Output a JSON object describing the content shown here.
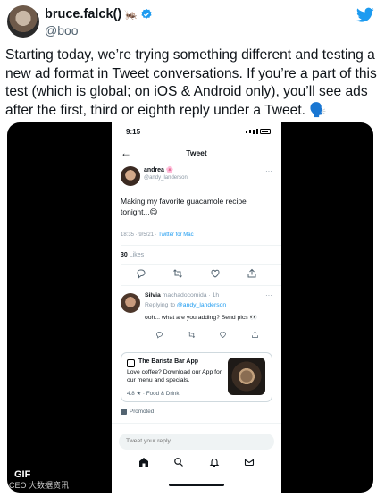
{
  "tweet": {
    "display_name": "bruce.falck()",
    "name_emoji": "🦗",
    "handle": "@boo",
    "text": "Starting today, we’re trying something different and testing a new ad format in Tweet conversations. If you’re a part of this test (which is global; on iOS & Android only), you’ll see ads after the first, third or eighth reply under a Tweet. 🗣️",
    "brand_color": "#1d9bf0"
  },
  "media": {
    "badge": "GIF",
    "watermark": "CEO 大数据资讯"
  },
  "phone": {
    "status_time": "9:15",
    "nav_title": "Tweet",
    "original": {
      "name": "andrea 🌸",
      "handle": "@andy_landerson",
      "text": "Making my favorite guacamole recipe tonight...😋",
      "timestamp": "18:35 · 9/5/21 ·",
      "source": "Twitter for Mac",
      "likes_count": "30",
      "likes_label": "Likes"
    },
    "reply": {
      "name": "Silvia",
      "handle_time": "machadocomida · 1h",
      "replying_to_label": "Replying to",
      "replying_to_handle": "@andy_landerson",
      "text": "ooh... what are you adding? Send pics 👀"
    },
    "ad": {
      "title": "The Barista Bar App",
      "body": "Love coffee? Download our App for our menu and specials.",
      "rating": "4.8 ★ · Food & Drink",
      "promoted_label": "Promoted"
    },
    "compose_placeholder": "Tweet your reply"
  }
}
